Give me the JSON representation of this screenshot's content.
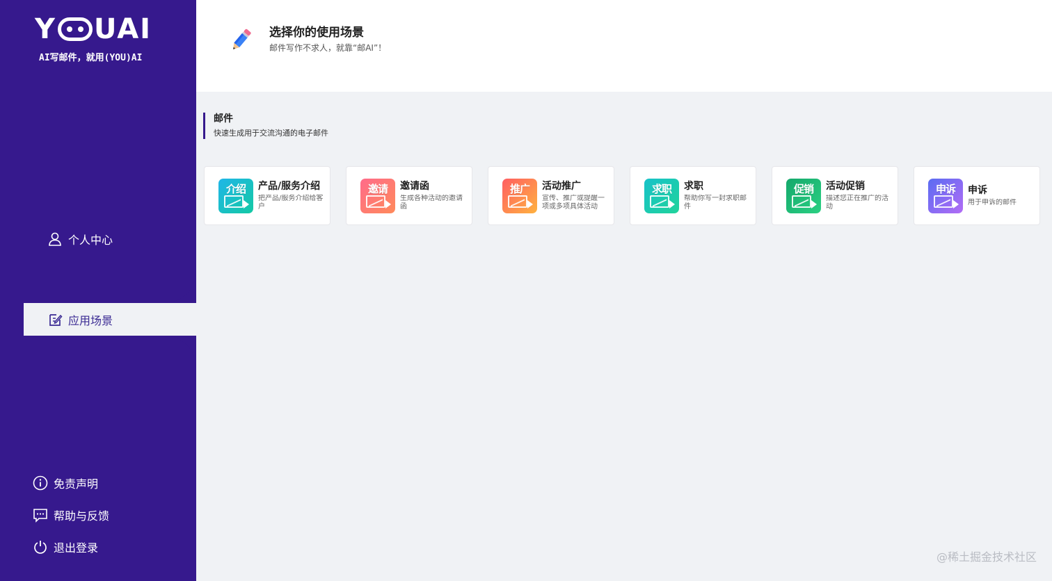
{
  "brand": {
    "logo_text_left": "Y",
    "logo_text_right": "UAI",
    "tagline": "AI写邮件，就用(YOU)AI"
  },
  "sidebar": {
    "items": [
      {
        "label": "个人中心",
        "icon": "user-icon"
      },
      {
        "label": "应用场景",
        "icon": "edit-icon",
        "active": true
      }
    ],
    "footer_items": [
      {
        "label": "免责声明",
        "icon": "info-circle-icon"
      },
      {
        "label": "帮助与反馈",
        "icon": "feedback-icon"
      },
      {
        "label": "退出登录",
        "icon": "power-icon"
      }
    ]
  },
  "header": {
    "icon": "pencil-icon",
    "title": "选择你的使用场景",
    "subtitle": "邮件写作不求人，就靠“邮AI”！"
  },
  "section": {
    "title": "邮件",
    "subtitle": "快速生成用于交流沟通的电子邮件"
  },
  "cards": [
    {
      "title": "产品/服务介绍",
      "desc": "把产品/服务介绍给客户",
      "tag": "介绍",
      "colors": [
        "#1fb6e8",
        "#14c9a4"
      ]
    },
    {
      "title": "邀请函",
      "desc": "生成各种活动的邀请函",
      "tag": "邀请",
      "colors": [
        "#ff6b8a",
        "#ff8a5b"
      ]
    },
    {
      "title": "活动推广",
      "desc": "宣传、推广或提醒一项或多项具体活动",
      "tag": "推广",
      "colors": [
        "#ff5e62",
        "#ffb23f"
      ]
    },
    {
      "title": "求职",
      "desc": "帮助你写一封求职邮件",
      "tag": "求职",
      "colors": [
        "#17c2c9",
        "#21d39b"
      ]
    },
    {
      "title": "活动促销",
      "desc": "描述您正在推广的活动",
      "tag": "促销",
      "colors": [
        "#14a86b",
        "#2bd083"
      ]
    },
    {
      "title": "申诉",
      "desc": "用于申诉的邮件",
      "tag": "申诉",
      "colors": [
        "#5a6cf2",
        "#b26cf5"
      ]
    }
  ],
  "watermark": "@稀土掘金技术社区",
  "colors": {
    "sidebar_bg": "#36198d",
    "content_bg": "#f0f2f5",
    "accent": "#3a2a93"
  }
}
